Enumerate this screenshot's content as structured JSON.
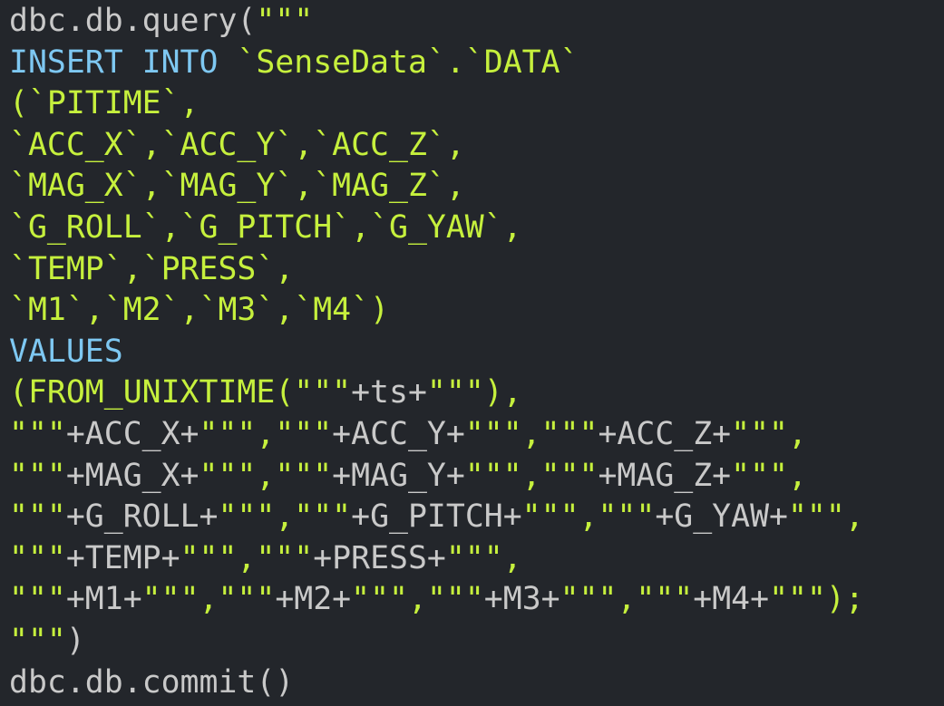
{
  "lines": [
    [
      {
        "t": "dbc.db.query(",
        "c": "plain"
      },
      {
        "t": "\"\"\"",
        "c": "str"
      }
    ],
    [
      {
        "t": "INSERT INTO ",
        "c": "kw"
      },
      {
        "t": "`SenseData`.`DATA`",
        "c": "str"
      }
    ],
    [
      {
        "t": "(`PITIME`,",
        "c": "str"
      }
    ],
    [
      {
        "t": "`ACC_X`,`ACC_Y`,`ACC_Z`,",
        "c": "str"
      }
    ],
    [
      {
        "t": "`MAG_X`,`MAG_Y`,`MAG_Z`,",
        "c": "str"
      }
    ],
    [
      {
        "t": "`G_ROLL`,`G_PITCH`,`G_YAW`,",
        "c": "str"
      }
    ],
    [
      {
        "t": "`TEMP`,`PRESS`,",
        "c": "str"
      }
    ],
    [
      {
        "t": "`M1`,`M2`,`M3`,`M4`)",
        "c": "str"
      }
    ],
    [
      {
        "t": "VALUES",
        "c": "kw"
      }
    ],
    [
      {
        "t": "(FROM_UNIXTIME(",
        "c": "str"
      },
      {
        "t": "\"\"\"",
        "c": "str"
      },
      {
        "t": "+ts+",
        "c": "id"
      },
      {
        "t": "\"\"\"",
        "c": "str"
      },
      {
        "t": "),",
        "c": "str"
      }
    ],
    [
      {
        "t": "\"\"\"",
        "c": "str"
      },
      {
        "t": "+ACC_X+",
        "c": "id"
      },
      {
        "t": "\"\"\",\"\"\"",
        "c": "str"
      },
      {
        "t": "+ACC_Y+",
        "c": "id"
      },
      {
        "t": "\"\"\",\"\"\"",
        "c": "str"
      },
      {
        "t": "+ACC_Z+",
        "c": "id"
      },
      {
        "t": "\"\"\",",
        "c": "str"
      }
    ],
    [
      {
        "t": "\"\"\"",
        "c": "str"
      },
      {
        "t": "+MAG_X+",
        "c": "id"
      },
      {
        "t": "\"\"\",\"\"\"",
        "c": "str"
      },
      {
        "t": "+MAG_Y+",
        "c": "id"
      },
      {
        "t": "\"\"\",\"\"\"",
        "c": "str"
      },
      {
        "t": "+MAG_Z+",
        "c": "id"
      },
      {
        "t": "\"\"\",",
        "c": "str"
      }
    ],
    [
      {
        "t": "\"\"\"",
        "c": "str"
      },
      {
        "t": "+G_ROLL+",
        "c": "id"
      },
      {
        "t": "\"\"\",\"\"\"",
        "c": "str"
      },
      {
        "t": "+G_PITCH+",
        "c": "id"
      },
      {
        "t": "\"\"\",\"\"\"",
        "c": "str"
      },
      {
        "t": "+G_YAW+",
        "c": "id"
      },
      {
        "t": "\"\"\",",
        "c": "str"
      }
    ],
    [
      {
        "t": "\"\"\"",
        "c": "str"
      },
      {
        "t": "+TEMP+",
        "c": "id"
      },
      {
        "t": "\"\"\",\"\"\"",
        "c": "str"
      },
      {
        "t": "+PRESS+",
        "c": "id"
      },
      {
        "t": "\"\"\",",
        "c": "str"
      }
    ],
    [
      {
        "t": "\"\"\"",
        "c": "str"
      },
      {
        "t": "+M1+",
        "c": "id"
      },
      {
        "t": "\"\"\",\"\"\"",
        "c": "str"
      },
      {
        "t": "+M2+",
        "c": "id"
      },
      {
        "t": "\"\"\",\"\"\"",
        "c": "str"
      },
      {
        "t": "+M3+",
        "c": "id"
      },
      {
        "t": "\"\"\",\"\"\"",
        "c": "str"
      },
      {
        "t": "+M4+",
        "c": "id"
      },
      {
        "t": "\"\"\");",
        "c": "str"
      }
    ],
    [
      {
        "t": "\"\"\"",
        "c": "str"
      },
      {
        "t": ")",
        "c": "plain"
      }
    ],
    [
      {
        "t": "dbc.db.commit()",
        "c": "plain"
      }
    ]
  ]
}
